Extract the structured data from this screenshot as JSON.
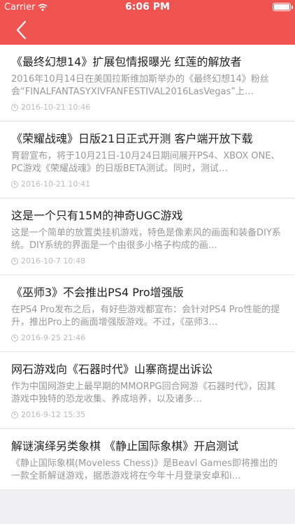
{
  "status_bar": {
    "carrier": "Carrier",
    "time": "6:06 PM"
  },
  "nav": {
    "back_icon": "chevron-left-icon"
  },
  "colors": {
    "header_bg": "#ef5350",
    "list_bg": "#ffffff",
    "page_bg": "#efeff4"
  },
  "articles": [
    {
      "title": "《最终幻想14》扩展包情报曝光 红莲的解放者",
      "summary": "2016年10月14日在美国拉斯维加斯举办的《最终幻想14》粉丝会“FINALFANTASYXIVFANFESTIVAL2016LasVegas”上…",
      "date": "2016-10-21 10:46"
    },
    {
      "title": "《荣耀战魂》日版21日正式开测 客户端开放下载",
      "summary": "育碧宣布，将于10月21日-10月24日期间展开PS4、XBOX ONE、PC游戏《荣耀战魂》的日版BETA测试。同时，测试…",
      "date": "2016-10-21 10:41"
    },
    {
      "title": "这是一个只有15M的神奇UGC游戏",
      "summary": "这是一个简单的放置类挂机游戏，特色是像素风的画面和装备DIY系统。DIY系统的界面是一个由很多小格子构成的画…",
      "date": "2016-10-7 10:48"
    },
    {
      "title": "《巫师3》不会推出PS4 Pro增强版",
      "summary": "在PS4 Pro发布之后，有好些游戏都宣布：会针对PS4 Pro性能的提升，推出Pro上的画面增强版游戏。不过，《巫师3…",
      "date": "2016-9-25 21:46"
    },
    {
      "title": "网石游戏向《石器时代》山寨商提出诉讼",
      "summary": "作为中国网游史上最早期的MMORPG回合网游《石器时代》，因其游戏中独特的恐龙收集、养成培养，以及诸多…",
      "date": "2016-9-12 15:35"
    },
    {
      "title": "解谜演绎另类象棋 《静止国际象棋》开启测试",
      "summary": "《静止国际象棋(Moveless Chess)》是Beavl Games即将推出的一款全新解谜游戏，据悉游戏将在今年十月登录安卓和i…",
      "date": ""
    }
  ]
}
